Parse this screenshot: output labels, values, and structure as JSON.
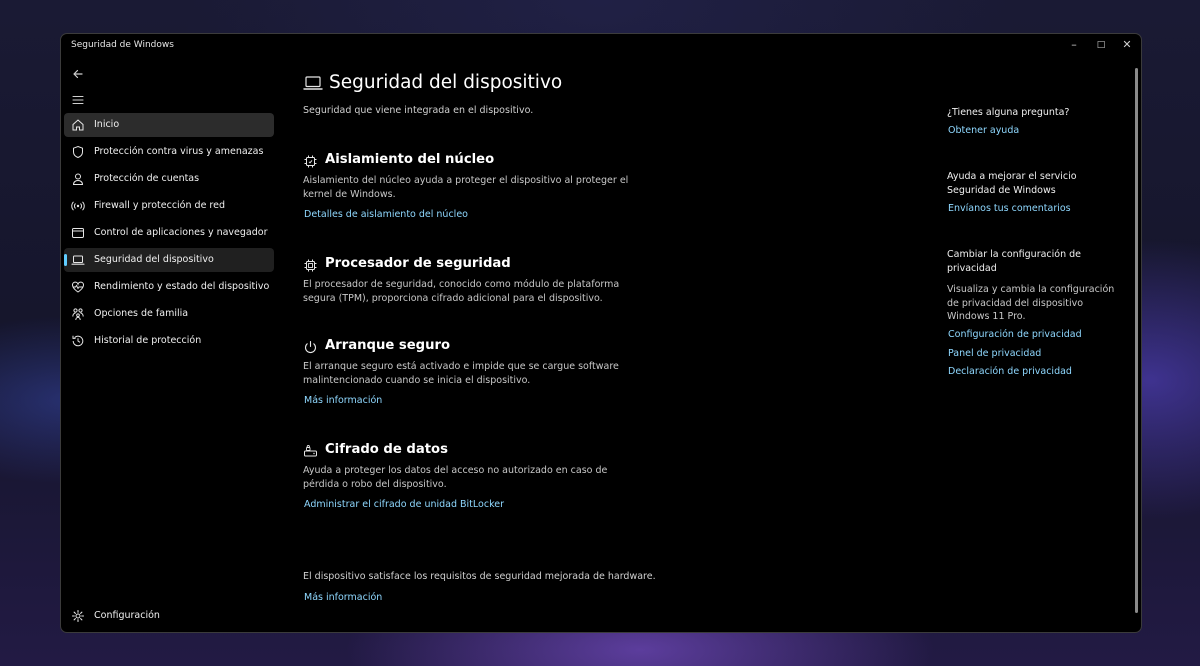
{
  "window": {
    "title": "Seguridad de Windows",
    "controls": {
      "minimize": "–",
      "maximize": "□",
      "close": "✕"
    }
  },
  "sidebar": {
    "items": [
      {
        "label": "Inicio",
        "icon": "home-icon"
      },
      {
        "label": "Protección contra virus y amenazas",
        "icon": "shield-icon"
      },
      {
        "label": "Protección de cuentas",
        "icon": "person-icon"
      },
      {
        "label": "Firewall y protección de red",
        "icon": "wifi-antenna-icon"
      },
      {
        "label": "Control de aplicaciones y navegador",
        "icon": "app-browser-icon"
      },
      {
        "label": "Seguridad del dispositivo",
        "icon": "laptop-icon"
      },
      {
        "label": "Rendimiento y estado del dispositivo",
        "icon": "heart-pulse-icon"
      },
      {
        "label": "Opciones de familia",
        "icon": "family-icon"
      },
      {
        "label": "Historial de protección",
        "icon": "history-icon"
      }
    ],
    "selected_index": 5,
    "settings_label": "Configuración"
  },
  "main": {
    "title": "Seguridad del dispositivo",
    "subtitle": "Seguridad que viene integrada en el dispositivo.",
    "sections": [
      {
        "title": "Aislamiento del núcleo",
        "description": "Aislamiento del núcleo ayuda a proteger el dispositivo al proteger el kernel de Windows.",
        "link": "Detalles de aislamiento del núcleo"
      },
      {
        "title": "Procesador de seguridad",
        "description": "El procesador de seguridad, conocido como módulo de plataforma segura (TPM), proporciona cifrado adicional para el dispositivo.",
        "link": ""
      },
      {
        "title": "Arranque seguro",
        "description": "El arranque seguro está activado e impide que se cargue software malintencionado cuando se inicia el dispositivo.",
        "link": "Más información"
      },
      {
        "title": "Cifrado de datos",
        "description": "Ayuda a proteger los datos del acceso no autorizado en caso de pérdida o robo del dispositivo.",
        "link": "Administrar el cifrado de unidad BitLocker"
      }
    ],
    "footer_text": "El dispositivo satisface los requisitos de seguridad mejorada de hardware.",
    "footer_link": "Más información"
  },
  "right_panel": {
    "question_heading": "¿Tienes alguna pregunta?",
    "help_link": "Obtener ayuda",
    "improve_heading": "Ayuda a mejorar el servicio Seguridad de Windows",
    "feedback_link": "Envíanos tus comentarios",
    "privacy_heading": "Cambiar la configuración de privacidad",
    "privacy_text": "Visualiza y cambia la configuración de privacidad del dispositivo Windows 11 Pro.",
    "privacy_links": [
      "Configuración de privacidad",
      "Panel de privacidad",
      "Declaración de privacidad"
    ]
  },
  "colors": {
    "accent": "#60cdff",
    "link": "#8fd8ff",
    "selected_bg": "#2c2c2c"
  }
}
